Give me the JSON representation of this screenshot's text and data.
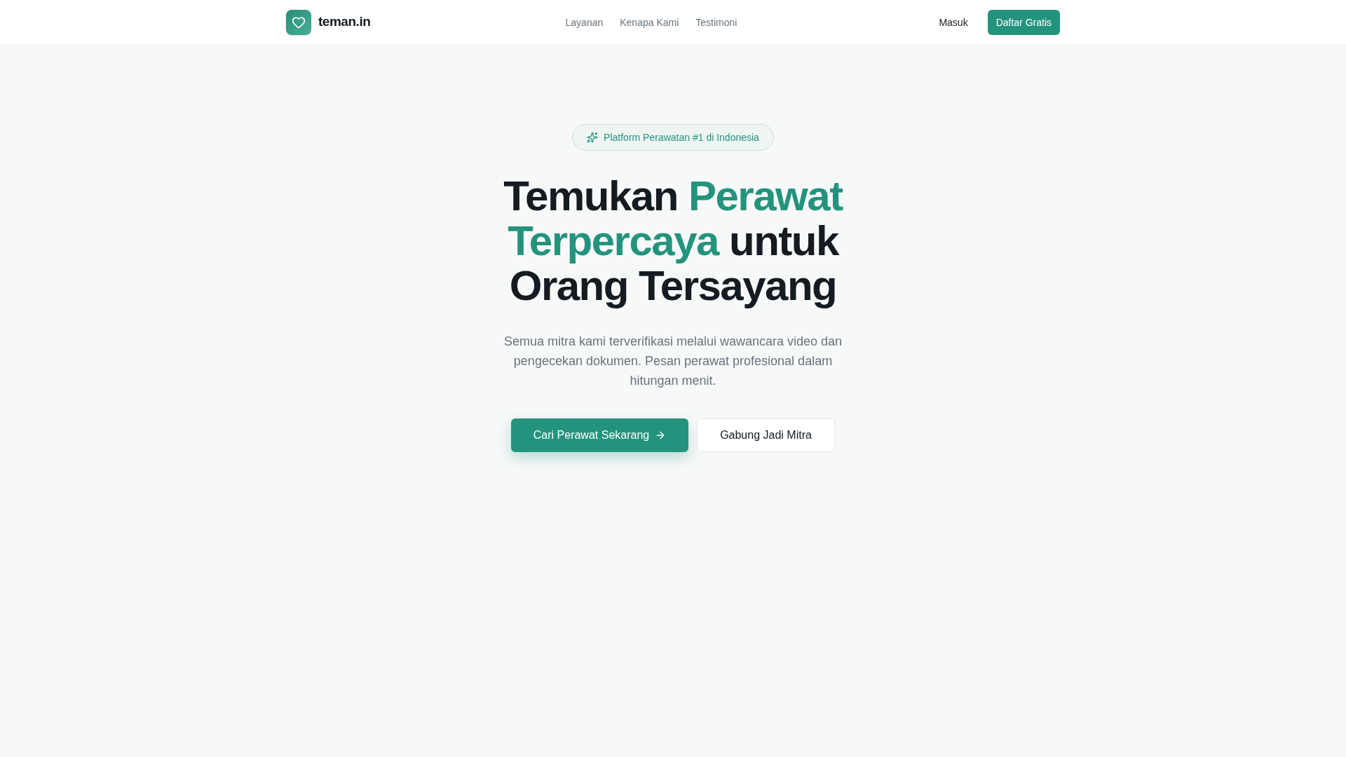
{
  "nav": {
    "brand": "teman.in",
    "links": [
      "Layanan",
      "Kenapa Kami",
      "Testimoni"
    ],
    "login": "Masuk",
    "signup": "Daftar Gratis"
  },
  "hero": {
    "badge": "Platform Perawatan #1 di Indonesia",
    "heading": [
      {
        "text": "Temukan ",
        "highlight": false
      },
      {
        "text": "Perawat Terpercaya",
        "highlight": true
      },
      {
        "text": " untuk Orang Tersayang",
        "highlight": false
      }
    ],
    "description": "Semua mitra kami terverifikasi melalui wawancara video dan pengecekan dokumen. Pesan perawat profesional dalam hitungan menit.",
    "primary_button": "Cari Perawat Sekarang",
    "secondary_button": "Gabung Jadi Mitra"
  }
}
